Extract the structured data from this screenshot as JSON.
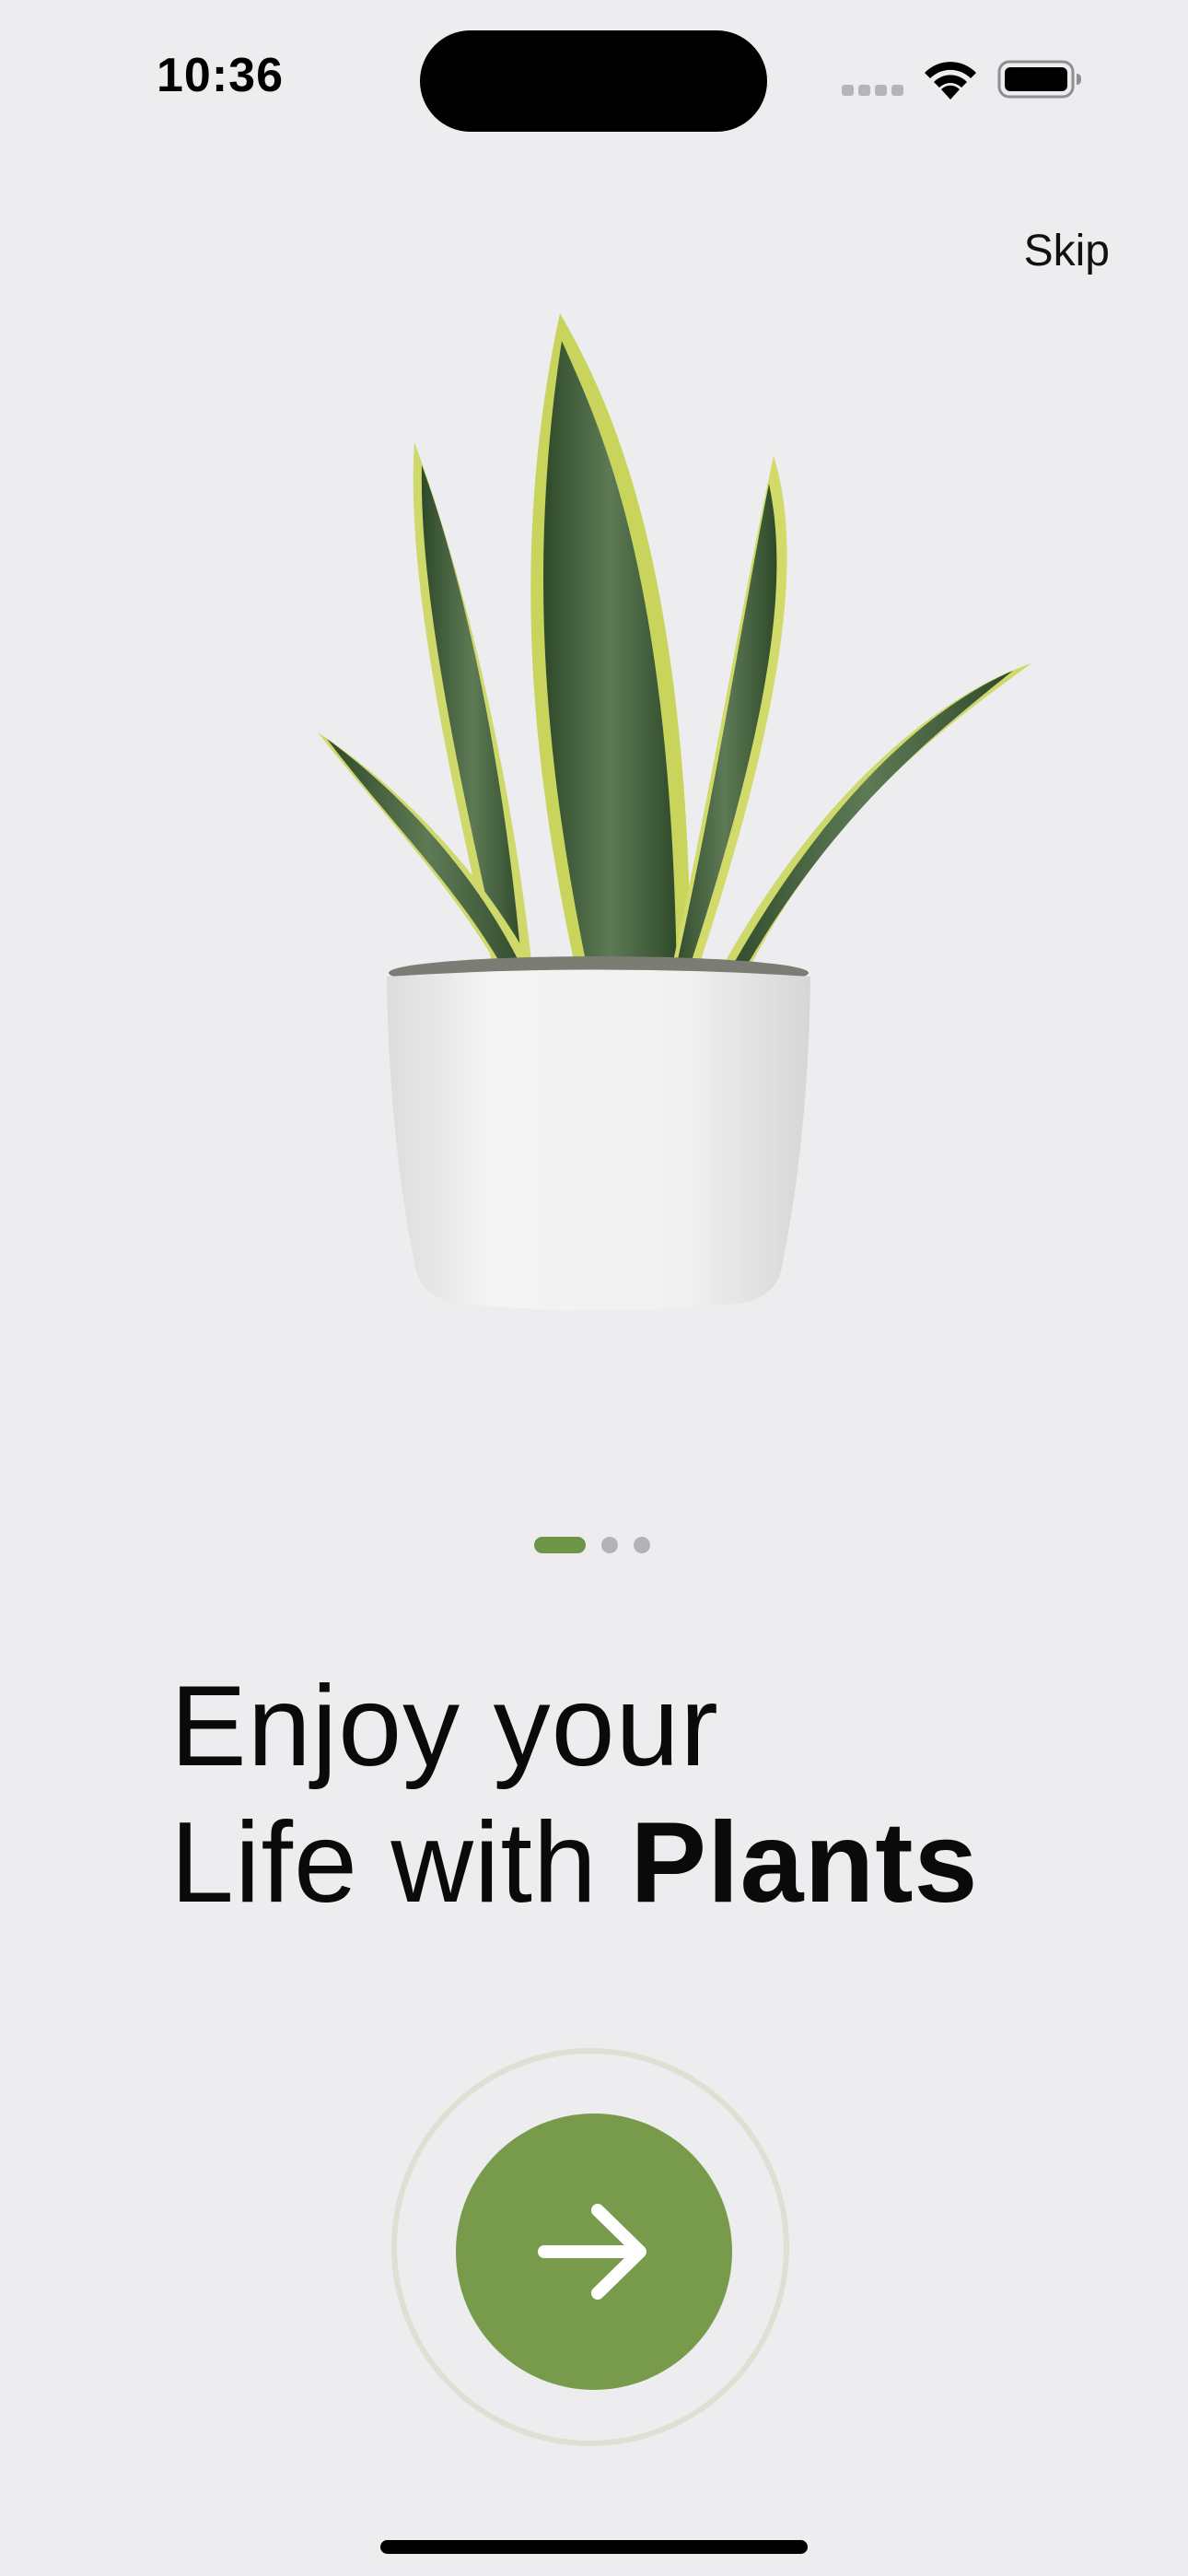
{
  "status_bar": {
    "time": "10:36"
  },
  "onboarding": {
    "skip_label": "Skip",
    "headline_line1": "Enjoy your",
    "headline_line2_regular": "Life with ",
    "headline_line2_bold": "Plants",
    "page_indicator": {
      "total_pages": 3,
      "current_page": 1
    },
    "next_icon": "arrow-right-icon",
    "illustration_icon": "potted-snake-plant"
  },
  "colors": {
    "background": "#ededf0",
    "accent_green": "#789a4b",
    "indicator_active": "#6e9447",
    "indicator_inactive": "#b3b3b6",
    "ring": "#dbe1d3"
  }
}
